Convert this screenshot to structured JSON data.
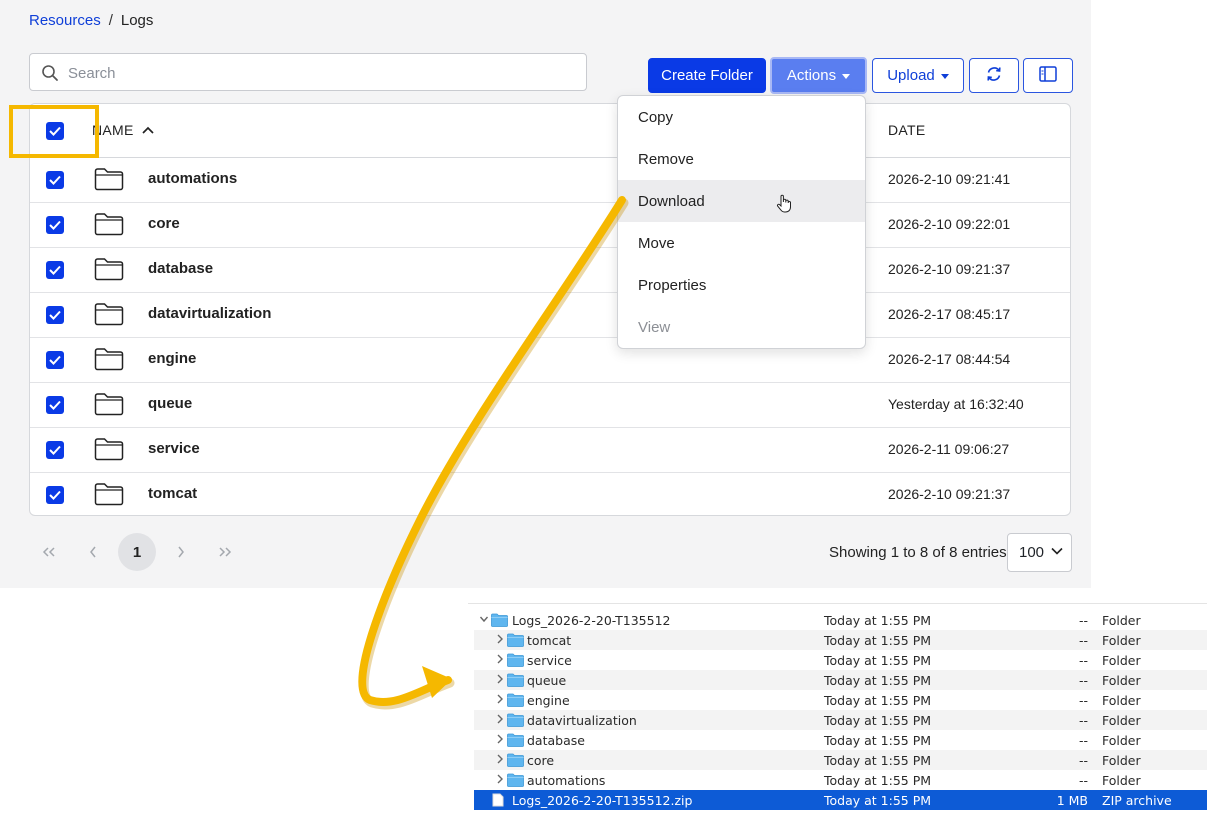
{
  "breadcrumb": {
    "link": "Resources",
    "separator": "/",
    "current": "Logs"
  },
  "search": {
    "placeholder": "Search"
  },
  "toolbar": {
    "create_folder": "Create Folder",
    "actions": "Actions",
    "upload": "Upload"
  },
  "table": {
    "columns": {
      "name": "NAME",
      "date": "DATE"
    },
    "rows": [
      {
        "name": "automations",
        "date": "2026-2-10 09:21:41"
      },
      {
        "name": "core",
        "date": "2026-2-10 09:22:01"
      },
      {
        "name": "database",
        "date": "2026-2-10 09:21:37"
      },
      {
        "name": "datavirtualization",
        "date": "2026-2-17 08:45:17"
      },
      {
        "name": "engine",
        "date": "2026-2-17 08:44:54"
      },
      {
        "name": "queue",
        "date": "Yesterday at 16:32:40"
      },
      {
        "name": "service",
        "date": "2026-2-11 09:06:27"
      },
      {
        "name": "tomcat",
        "date": "2026-2-10 09:21:37"
      }
    ]
  },
  "actions_menu": {
    "items": [
      {
        "label": "Copy"
      },
      {
        "label": "Remove"
      },
      {
        "label": "Download"
      },
      {
        "label": "Move"
      },
      {
        "label": "Properties"
      },
      {
        "label": "View"
      }
    ]
  },
  "pagination": {
    "first": "«",
    "prev": "‹",
    "current": "1",
    "next": "›",
    "last": "»",
    "showing": "Showing 1 to 8 of 8 entries",
    "page_size": "100"
  },
  "finder": {
    "rows": [
      {
        "name": "Logs_2026-2-20-T135512",
        "date": "Today at 1:55 PM",
        "size": "--",
        "kind": "Folder"
      },
      {
        "name": "tomcat",
        "date": "Today at 1:55 PM",
        "size": "--",
        "kind": "Folder"
      },
      {
        "name": "service",
        "date": "Today at 1:55 PM",
        "size": "--",
        "kind": "Folder"
      },
      {
        "name": "queue",
        "date": "Today at 1:55 PM",
        "size": "--",
        "kind": "Folder"
      },
      {
        "name": "engine",
        "date": "Today at 1:55 PM",
        "size": "--",
        "kind": "Folder"
      },
      {
        "name": "datavirtualization",
        "date": "Today at 1:55 PM",
        "size": "--",
        "kind": "Folder"
      },
      {
        "name": "database",
        "date": "Today at 1:55 PM",
        "size": "--",
        "kind": "Folder"
      },
      {
        "name": "core",
        "date": "Today at 1:55 PM",
        "size": "--",
        "kind": "Folder"
      },
      {
        "name": "automations",
        "date": "Today at 1:55 PM",
        "size": "--",
        "kind": "Folder"
      },
      {
        "name": "Logs_2026-2-20-T135512.zip",
        "date": "Today at 1:55 PM",
        "size": "1 MB",
        "kind": "ZIP archive"
      }
    ]
  },
  "colors": {
    "primary": "#0a3ae6",
    "link": "#0f3fd8",
    "highlight": "#f5b800",
    "finder_selection": "#0d5bd6",
    "folder_icon": "#5fb6ef"
  }
}
